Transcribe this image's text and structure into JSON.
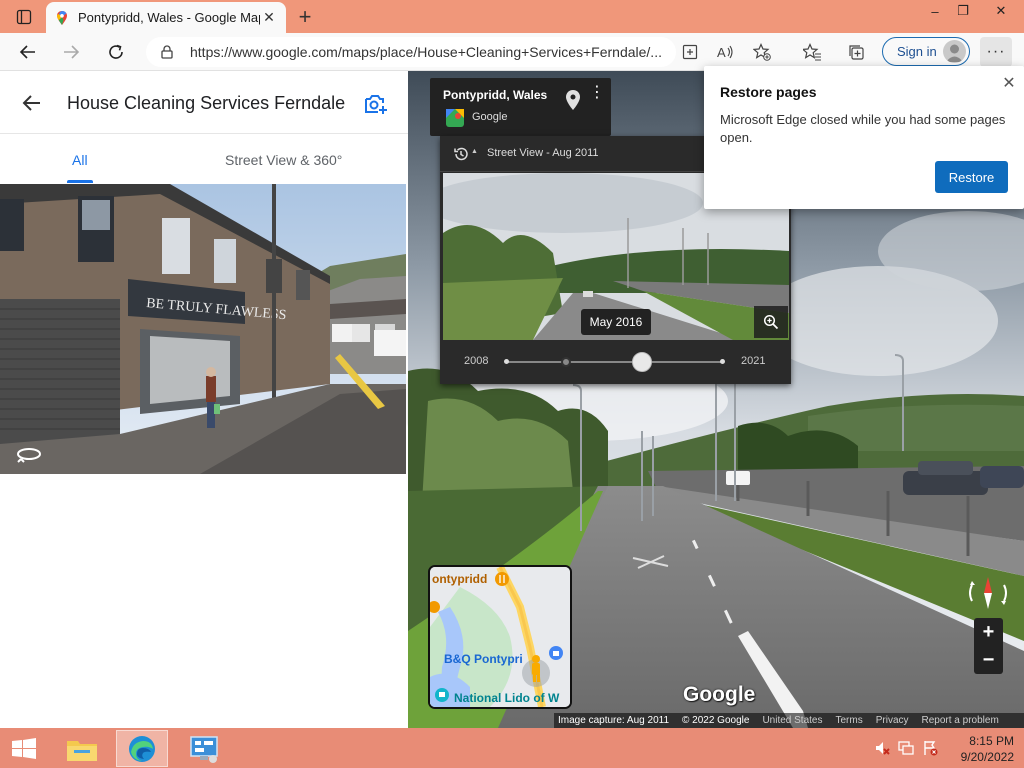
{
  "browser": {
    "tab_title": "Pontypridd, Wales - Google Maps",
    "tab_close": "✕",
    "new_tab": "+",
    "url": "https://www.google.com/maps/place/House+Cleaning+Services+Ferndale/...",
    "signin_label": "Sign in",
    "more_label": "···",
    "window_controls": {
      "minimize": "–",
      "restore": "❐",
      "close": "✕"
    }
  },
  "left_panel": {
    "title": "House Cleaning Services Ferndale",
    "tabs": [
      {
        "label": "All",
        "active": true
      },
      {
        "label": "Street View & 360°",
        "active": false
      }
    ],
    "shop_sign": "BE TRULY FLAWLESS"
  },
  "street_view": {
    "place_name": "Pontypridd, Wales",
    "provider": "Google",
    "time_machine": {
      "header": "Street View - Aug 2011",
      "selected_date": "May 2016",
      "start_year": "2008",
      "end_year": "2021",
      "slider_position": 0.63
    },
    "watermark": "Google",
    "footer": {
      "capture": "Image capture: Aug 2011",
      "copyright": "© 2022 Google",
      "links": [
        "United States",
        "Terms",
        "Privacy",
        "Report a problem"
      ]
    },
    "zoom_in": "+",
    "zoom_out": "−",
    "minimap_labels": {
      "town": "ontypridd",
      "store": "B&Q Pontypri",
      "lido": "National Lido of W"
    }
  },
  "restore_popup": {
    "title": "Restore pages",
    "message": "Microsoft Edge closed while you had some pages open.",
    "button_label": "Restore",
    "close": "✕"
  },
  "taskbar": {
    "time": "8:15 PM",
    "date": "9/20/2022"
  },
  "colors": {
    "titlebar": "#f0977a",
    "taskbar": "#e88c76",
    "accent_blue": "#1a73e8",
    "edge_button": "#0f6cbd"
  }
}
